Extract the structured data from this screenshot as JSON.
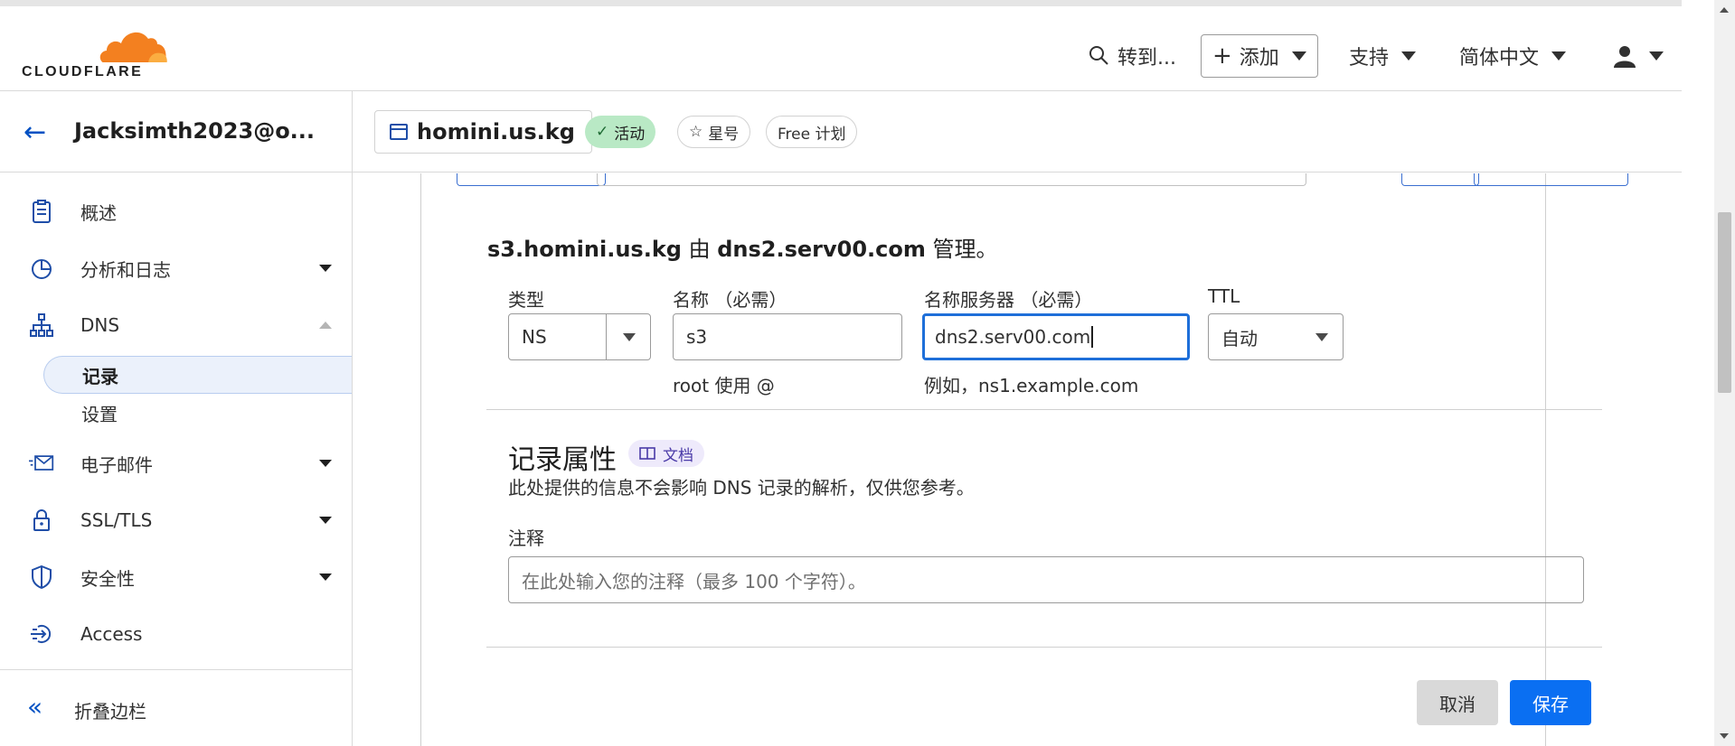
{
  "brand": {
    "logo_text": "CLOUDFLARE",
    "accent": "#f38020",
    "accent_light": "#fbad41"
  },
  "topbar": {
    "goto_label": "转到...",
    "add_label": "添加",
    "support_label": "支持",
    "language_label": "简体中文"
  },
  "sidebar": {
    "account_name": "Jacksimth2023@o...",
    "items": [
      {
        "label": "概述",
        "icon": "clipboard-icon"
      },
      {
        "label": "分析和日志",
        "icon": "pie-chart-icon"
      },
      {
        "label": "DNS",
        "icon": "network-icon"
      },
      {
        "label": "电子邮件",
        "icon": "email-icon"
      },
      {
        "label": "SSL/TLS",
        "icon": "lock-icon"
      },
      {
        "label": "安全性",
        "icon": "shield-icon"
      },
      {
        "label": "Access",
        "icon": "access-icon"
      }
    ],
    "dns_sub": [
      {
        "label": "记录"
      },
      {
        "label": "设置"
      }
    ],
    "collapse_label": "折叠边栏"
  },
  "zone": {
    "name": "homini.us.kg",
    "status": "活动",
    "star_label": "星号",
    "plan": "Free 计划"
  },
  "record_form": {
    "manage_subject": "s3.homini.us.kg",
    "manage_by": "由",
    "manage_server": "dns2.serv00.com",
    "manage_suffix": "管理。",
    "type_label": "类型",
    "type_value": "NS",
    "name_label": "名称 （必需）",
    "name_value": "s3",
    "name_hint": "root 使用 @",
    "ns_label": "名称服务器 （必需）",
    "ns_value": "dns2.serv00.com",
    "ns_hint": "例如，ns1.example.com",
    "ttl_label": "TTL",
    "ttl_value": "自动"
  },
  "record_attributes": {
    "title": "记录属性",
    "doc_label": "文档",
    "description": "此处提供的信息不会影响 DNS 记录的解析，仅供您参考。",
    "note_label": "注释",
    "note_placeholder": "在此处输入您的注释（最多 100 个字符）。"
  },
  "actions": {
    "cancel_label": "取消",
    "save_label": "保存"
  }
}
